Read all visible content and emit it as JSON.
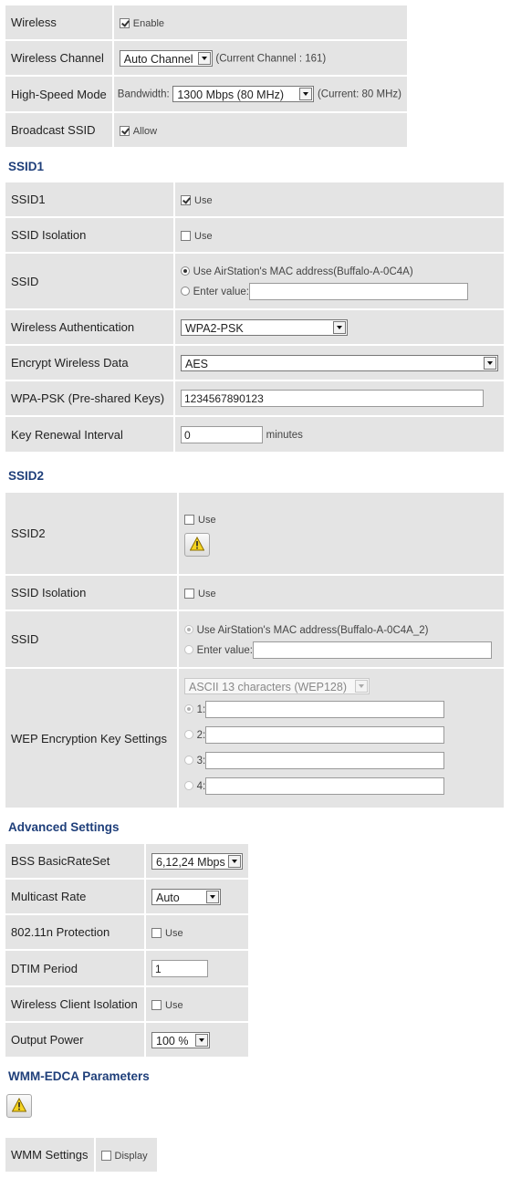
{
  "basic": {
    "wireless_label": "Wireless",
    "wireless_enable": "Enable",
    "channel_label": "Wireless Channel",
    "channel_value": "Auto Channel",
    "channel_current": "(Current Channel : 161)",
    "hsmode_label": "High-Speed Mode",
    "bandwidth_label": "Bandwidth:",
    "bandwidth_value": "1300 Mbps (80 MHz)",
    "bandwidth_current": "(Current: 80 MHz)",
    "bssid_label": "Broadcast SSID",
    "bssid_allow": "Allow"
  },
  "ssid1": {
    "heading": "SSID1",
    "ssid1_label": "SSID1",
    "use": "Use",
    "isolation_label": "SSID Isolation",
    "ssid_label": "SSID",
    "mac_option": "Use AirStation's MAC address(Buffalo-A-0C4A)",
    "enter_value": "Enter value:",
    "auth_label": "Wireless Authentication",
    "auth_value": "WPA2-PSK",
    "encrypt_label": "Encrypt Wireless Data",
    "encrypt_value": "AES",
    "psk_label": "WPA-PSK (Pre-shared Keys)",
    "psk_value": "1234567890123",
    "renewal_label": "Key Renewal Interval",
    "renewal_value": "0",
    "renewal_unit": "minutes"
  },
  "ssid2": {
    "heading": "SSID2",
    "ssid2_label": "SSID2",
    "use": "Use",
    "isolation_label": "SSID Isolation",
    "ssid_label": "SSID",
    "mac_option": "Use AirStation's MAC address(Buffalo-A-0C4A_2)",
    "enter_value": "Enter value:",
    "wep_label": "WEP Encryption Key Settings",
    "wep_type": "ASCII 13 characters (WEP128)",
    "key1": "1:",
    "key2": "2:",
    "key3": "3:",
    "key4": "4:"
  },
  "advanced": {
    "heading": "Advanced Settings",
    "bss_label": "BSS BasicRateSet",
    "bss_value": "6,12,24 Mbps",
    "mcast_label": "Multicast Rate",
    "mcast_value": "Auto",
    "prot_label": "802.11n Protection",
    "use": "Use",
    "dtim_label": "DTIM Period",
    "dtim_value": "1",
    "iso_label": "Wireless Client Isolation",
    "power_label": "Output Power",
    "power_value": "100 %"
  },
  "wmm": {
    "heading": "WMM-EDCA Parameters",
    "settings_label": "WMM Settings",
    "display": "Display"
  },
  "icons": {
    "warning": "warning-icon"
  }
}
